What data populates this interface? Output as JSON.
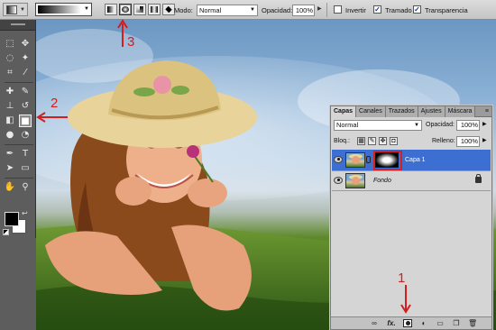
{
  "options_bar": {
    "mode_label": "Modo:",
    "mode_value": "Normal",
    "opacity_label": "Opacidad:",
    "opacity_value": "100%",
    "invert_label": "Invertir",
    "invert_checked": false,
    "dither_label": "Tramado",
    "dither_checked": true,
    "transparency_label": "Transparencia",
    "transparency_checked": true,
    "gradient_types": [
      "linear-gradient-icon",
      "radial-gradient-icon",
      "angle-gradient-icon",
      "reflected-gradient-icon",
      "diamond-gradient-icon"
    ],
    "active_gradient_type": "radial-gradient-icon"
  },
  "tools": {
    "active_tool": "gradient-tool",
    "foreground_color": "#000000",
    "background_color": "#ffffff"
  },
  "layers_panel": {
    "tabs": [
      "Capas",
      "Canales",
      "Trazados",
      "Ajustes",
      "Máscara"
    ],
    "active_tab": "Capas",
    "blend_mode": "Normal",
    "opacity_label": "Opacidad:",
    "opacity_value": "100%",
    "lock_label": "Bloq.:",
    "fill_label": "Relleno:",
    "fill_value": "100%",
    "layers": [
      {
        "name": "Capa 1",
        "selected": true,
        "has_mask": true
      },
      {
        "name": "Fondo",
        "selected": false,
        "locked": true
      }
    ],
    "bottom_icons": [
      "link-layers-icon",
      "fx-icon",
      "add-mask-icon",
      "adjustment-layer-icon",
      "group-folder-icon",
      "new-layer-icon",
      "trash-icon"
    ],
    "fx_label": "fx."
  },
  "annotations": {
    "one": "1",
    "two": "2",
    "three": "3"
  },
  "colors": {
    "annotation_red": "#d21e1e",
    "selection_blue": "#3c6fd1",
    "mask_frame_red": "#d42222"
  }
}
